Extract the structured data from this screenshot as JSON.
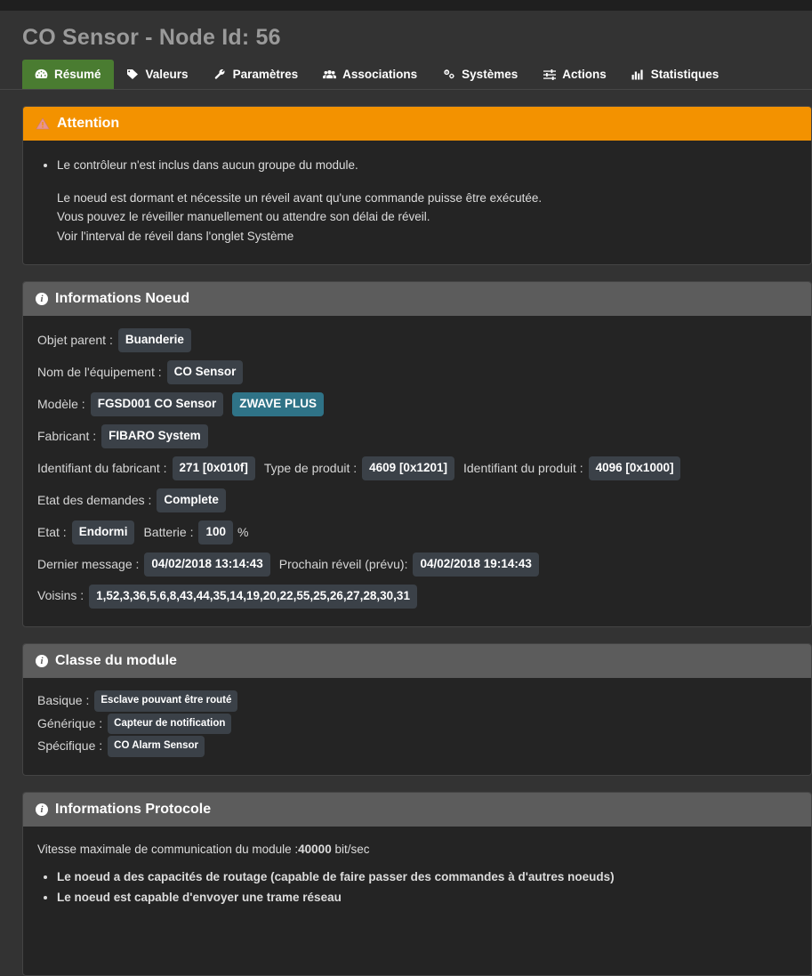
{
  "header": {
    "title": "CO Sensor - Node Id: 56"
  },
  "tabs": [
    {
      "label": "Résumé",
      "icon": "dashboard-icon",
      "active": true
    },
    {
      "label": "Valeurs",
      "icon": "tag-icon",
      "active": false
    },
    {
      "label": "Paramètres",
      "icon": "wrench-icon",
      "active": false
    },
    {
      "label": "Associations",
      "icon": "users-icon",
      "active": false
    },
    {
      "label": "Systèmes",
      "icon": "cogs-icon",
      "active": false
    },
    {
      "label": "Actions",
      "icon": "sliders-icon",
      "active": false
    },
    {
      "label": "Statistiques",
      "icon": "chart-bar-icon",
      "active": false
    }
  ],
  "warning": {
    "title": "Attention",
    "icon": "warning-triangle-icon",
    "bullets": [
      "Le contrôleur n'est inclus dans aucun groupe du module."
    ],
    "paragraph": [
      "Le noeud est dormant et nécessite un réveil avant qu'une commande puisse être exécutée.",
      "Vous pouvez le réveiller manuellement ou attendre son délai de réveil.",
      "Voir l'interval de réveil dans l'onglet Système"
    ]
  },
  "node_info": {
    "title": "Informations Noeud",
    "icon": "info-icon",
    "rows": [
      {
        "label": "Objet parent :",
        "value": "Buanderie"
      },
      {
        "label": "Nom de l'équipement :",
        "value": "CO Sensor"
      },
      {
        "label": "Modèle :",
        "value": "FGSD001 CO Sensor",
        "badge2": "ZWAVE PLUS"
      },
      {
        "label": "Fabricant :",
        "value": "FIBARO System"
      },
      {
        "label": "Identifiant du fabricant :",
        "value": "271 [0x010f]",
        "label2": "Type de produit :",
        "value2": "4609 [0x1201]",
        "label3": "Identifiant du produit :",
        "value3": "4096 [0x1000]"
      },
      {
        "label": "Etat des demandes :",
        "value": "Complete"
      },
      {
        "label": "Etat :",
        "value": "Endormi",
        "label2": "Batterie :",
        "value2": "100",
        "suffix2": "%"
      },
      {
        "label": "Dernier message :",
        "value": "04/02/2018 13:14:43",
        "label2": "Prochain réveil (prévu):",
        "value2": "04/02/2018 19:14:43"
      },
      {
        "label": "Voisins :",
        "value": "1,52,3,36,5,6,8,43,44,35,14,19,20,22,55,25,26,27,28,30,31"
      }
    ]
  },
  "module_class": {
    "title": "Classe du module",
    "icon": "info-icon",
    "rows": [
      {
        "label": "Basique :",
        "value": "Esclave pouvant être routé"
      },
      {
        "label": "Générique :",
        "value": "Capteur de notification"
      },
      {
        "label": "Spécifique :",
        "value": "CO Alarm Sensor"
      }
    ]
  },
  "protocol": {
    "title": "Informations Protocole",
    "icon": "info-icon",
    "speed_label": "Vitesse maximale de communication du module :",
    "speed_value": "40000",
    "speed_unit": " bit/sec",
    "capabilities": [
      "Le noeud a des capacités de routage (capable de faire passer des commandes à d'autres noeuds)",
      "Le noeud est capable d'envoyer une trame réseau"
    ]
  },
  "colors": {
    "page_bg": "#333333",
    "panel_bg": "#242424",
    "panel_head": "#5c5c5c",
    "warn_head": "#f39200",
    "tab_active": "#4a7c31",
    "badge": "#3b4148",
    "badge_teal": "#2f7387",
    "title": "#9a9a9a"
  }
}
